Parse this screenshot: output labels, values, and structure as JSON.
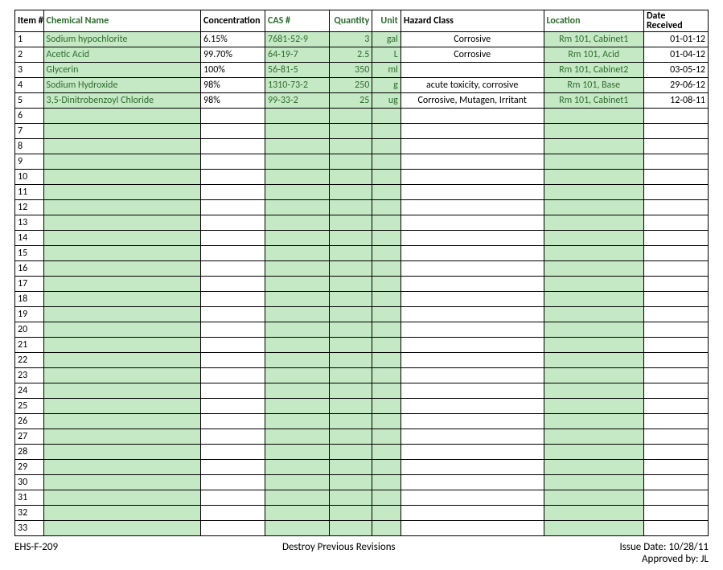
{
  "headers": {
    "item": "Item #",
    "chemical_name": "Chemical Name",
    "concentration": "Concentration",
    "cas": "CAS #",
    "quantity": "Quantity",
    "unit": "Unit",
    "hazard": "Hazard Class",
    "location": "Location",
    "date_line1": "Date",
    "date_line2": "Received"
  },
  "rows": [
    {
      "item": "1",
      "name": "Sodium hypochlorite",
      "conc": "6.15%",
      "cas": "7681-52-9",
      "qty": "3",
      "unit": "gal",
      "hazard": "Corrosive",
      "location": "Rm 101, Cabinet1",
      "date": "01-01-12"
    },
    {
      "item": "2",
      "name": "Acetic Acid",
      "conc": "99.70%",
      "cas": "64-19-7",
      "qty": "2.5",
      "unit": "L",
      "hazard": "Corrosive",
      "location": "Rm 101, Acid",
      "date": "01-04-12"
    },
    {
      "item": "3",
      "name": "Glycerin",
      "conc": "100%",
      "cas": "56-81-5",
      "qty": "350",
      "unit": "ml",
      "hazard": "",
      "location": "Rm 101, Cabinet2",
      "date": "03-05-12"
    },
    {
      "item": "4",
      "name": "Sodium Hydroxide",
      "conc": "98%",
      "cas": "1310-73-2",
      "qty": "250",
      "unit": "g",
      "hazard": "acute toxicity, corrosive",
      "location": "Rm 101, Base",
      "date": "29-06-12"
    },
    {
      "item": "5",
      "name": "3,5-Dinitrobenzoyl Chloride",
      "conc": "98%",
      "cas": "99-33-2",
      "qty": "25",
      "unit": "ug",
      "hazard": "Corrosive, Mutagen, Irritant",
      "location": "Rm 101, Cabinet1",
      "date": "12-08-11"
    }
  ],
  "blank_rows": [
    "6",
    "7",
    "8",
    "9",
    "10",
    "11",
    "12",
    "13",
    "14",
    "15",
    "16",
    "17",
    "18",
    "19",
    "20",
    "21",
    "22",
    "23",
    "24",
    "25",
    "26",
    "27",
    "28",
    "29",
    "30",
    "31",
    "32",
    "33"
  ],
  "footer": {
    "form_id": "EHS-F-209",
    "destroy": "Destroy Previous Revisions",
    "issue_date": "Issue Date: 10/28/11",
    "approved_by": "Approved by: JL"
  }
}
